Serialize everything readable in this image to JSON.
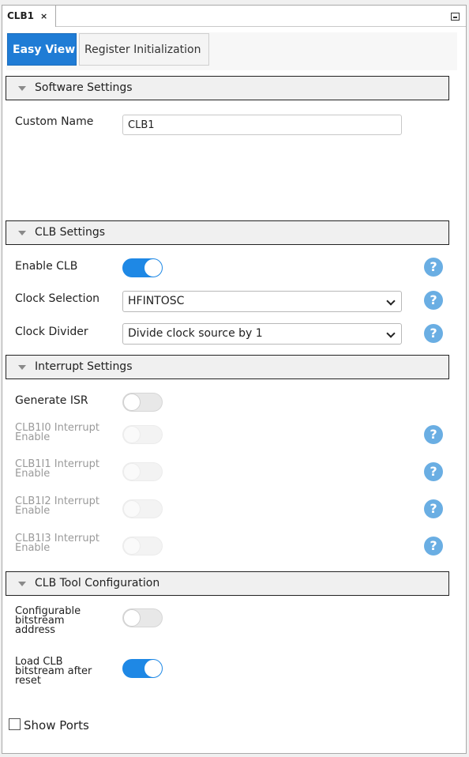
{
  "doc_tab": {
    "title": "CLB1",
    "close_glyph": "×"
  },
  "view_tabs": {
    "easy_view": "Easy View",
    "register_init": "Register Initialization"
  },
  "sections": {
    "software": "Software Settings",
    "clb": "CLB Settings",
    "interrupt": "Interrupt Settings",
    "tool": "CLB Tool Configuration"
  },
  "fields": {
    "custom_name": {
      "label": "Custom Name",
      "value": "CLB1"
    },
    "enable_clb": {
      "label": "Enable CLB",
      "state": "on"
    },
    "clock_selection": {
      "label": "Clock Selection",
      "value": "HFINTOSC"
    },
    "clock_divider": {
      "label": "Clock Divider",
      "value": "Divide clock source by 1"
    },
    "generate_isr": {
      "label": "Generate ISR",
      "state": "off"
    },
    "clb1i0": {
      "label_l1": "CLB1I0 Interrupt",
      "label_l2": "Enable",
      "state": "off-disabled"
    },
    "clb1i1": {
      "label_l1": "CLB1I1 Interrupt",
      "label_l2": "Enable",
      "state": "off-disabled"
    },
    "clb1i2": {
      "label_l1": "CLB1I2 Interrupt",
      "label_l2": "Enable",
      "state": "off-disabled"
    },
    "clb1i3": {
      "label_l1": "CLB1I3 Interrupt",
      "label_l2": "Enable",
      "state": "off-disabled"
    },
    "config_bitstream": {
      "label_l1": "Configurable",
      "label_l2": "bitstream",
      "label_l3": "address",
      "state": "off"
    },
    "load_bitstream": {
      "label_l1": "Load CLB",
      "label_l2": "bitstream after",
      "label_l3": "reset",
      "state": "on"
    }
  },
  "help_glyph": "?",
  "show_ports": {
    "label": "Show Ports",
    "checked": false
  },
  "colors": {
    "accent": "#1e88e5",
    "tab_active": "#1f7cd5",
    "help": "#6aaee3"
  },
  "icons": [
    "close-icon",
    "minimize-icon",
    "collapse-triangle-icon",
    "chevron-down-icon",
    "help-icon"
  ]
}
